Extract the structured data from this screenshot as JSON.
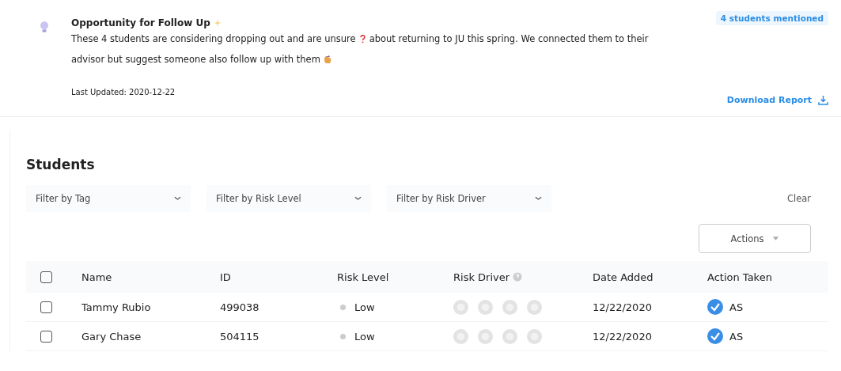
{
  "insight": {
    "title": "Opportunity for Follow Up",
    "badge": "4 students mentioned",
    "message_parts": [
      "These 4 students are considering dropping out and are unsure",
      "about returning to JU this spring. We connected them to their",
      "advisor but suggest someone also follow up with them"
    ],
    "last_updated": "Last Updated: 2020-12-22",
    "download": "Download Report"
  },
  "students": {
    "title": "Students",
    "filters": [
      "Filter by Tag",
      "Filter by Risk Level",
      "Filter by Risk Driver"
    ],
    "clear": "Clear",
    "select_all": false,
    "actions": "Actions",
    "columns": [
      "Name",
      "ID",
      "Risk Level",
      "Risk Driver",
      "Date Added",
      "Action Taken"
    ],
    "rows": [
      {
        "selected": false,
        "name": "Tammy Rubio",
        "id": "499038",
        "risk": "Low",
        "date": "12/22/2020",
        "action": "AS",
        "action_done": true
      },
      {
        "selected": false,
        "name": "Gary Chase",
        "id": "504115",
        "risk": "Low",
        "date": "12/22/2020",
        "action": "AS",
        "action_done": true
      }
    ]
  }
}
